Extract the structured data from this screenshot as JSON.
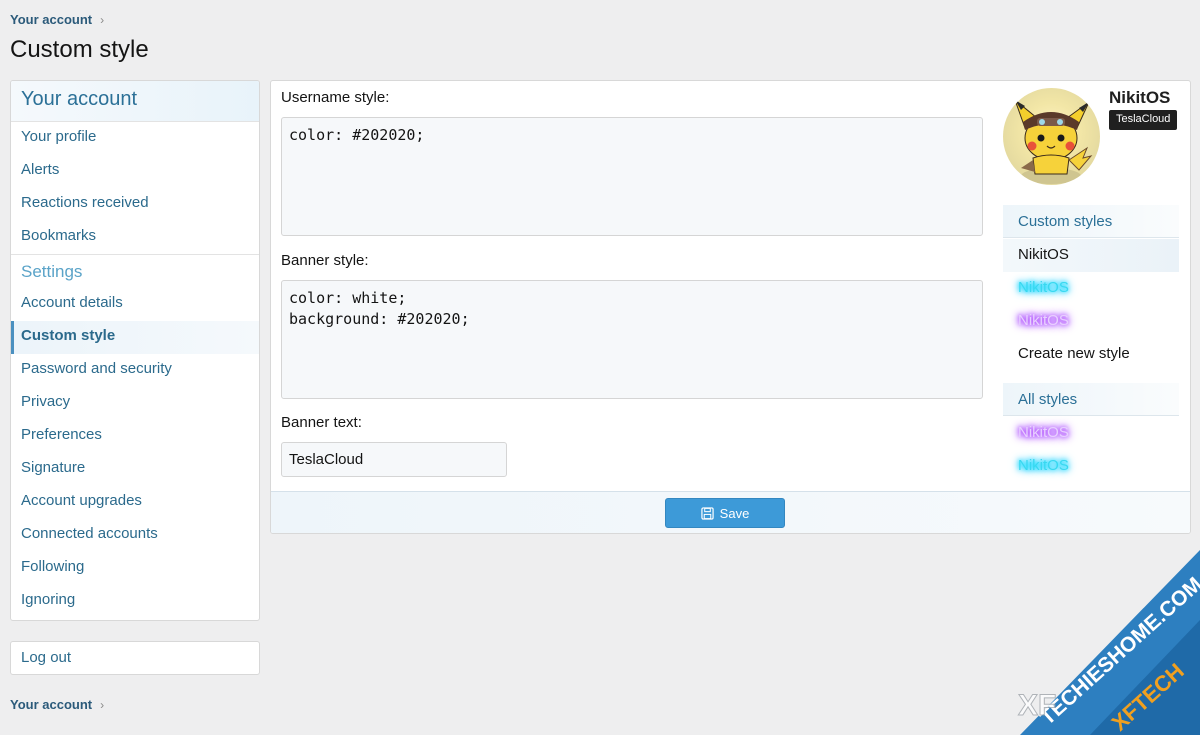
{
  "breadcrumb": {
    "label": "Your account"
  },
  "page": {
    "title": "Custom style"
  },
  "sidebar": {
    "header": "Your account",
    "items": [
      {
        "label": "Your profile"
      },
      {
        "label": "Alerts"
      },
      {
        "label": "Reactions received"
      },
      {
        "label": "Bookmarks"
      }
    ],
    "settings_header": "Settings",
    "settings_items": [
      {
        "label": "Account details"
      },
      {
        "label": "Custom style"
      },
      {
        "label": "Password and security"
      },
      {
        "label": "Privacy"
      },
      {
        "label": "Preferences"
      },
      {
        "label": "Signature"
      },
      {
        "label": "Account upgrades"
      },
      {
        "label": "Connected accounts"
      },
      {
        "label": "Following"
      },
      {
        "label": "Ignoring"
      }
    ],
    "logout": "Log out"
  },
  "form": {
    "username_style_label": "Username style:",
    "username_style_value": "color: #202020;",
    "banner_style_label": "Banner style:",
    "banner_style_value": "color: white;\nbackground: #202020;",
    "banner_text_label": "Banner text:",
    "banner_text_value": "TeslaCloud",
    "save_label": "Save"
  },
  "preview": {
    "username": "NikitOS",
    "banner": "TeslaCloud"
  },
  "custom_styles": {
    "header": "Custom styles",
    "items": [
      {
        "label": "NikitOS"
      },
      {
        "label": "NikitOS"
      },
      {
        "label": "NikitOS"
      }
    ],
    "create_label": "Create new style"
  },
  "all_styles": {
    "header": "All styles",
    "items": [
      {
        "label": "NikitOS"
      },
      {
        "label": "NikitOS"
      }
    ]
  },
  "watermark": {
    "line1": "TECHIESHOME.COM",
    "line2": "XFTECH"
  },
  "colors": {
    "accent": "#2b6a8c",
    "save_button": "#3d9ad8",
    "glow_cyan": "#00e5ff",
    "glow_purple": "#b040ff",
    "watermark": "#2d7fc0"
  },
  "icons": {
    "breadcrumb_chevron": "chevron-right-icon",
    "save": "floppy-disk-icon"
  }
}
